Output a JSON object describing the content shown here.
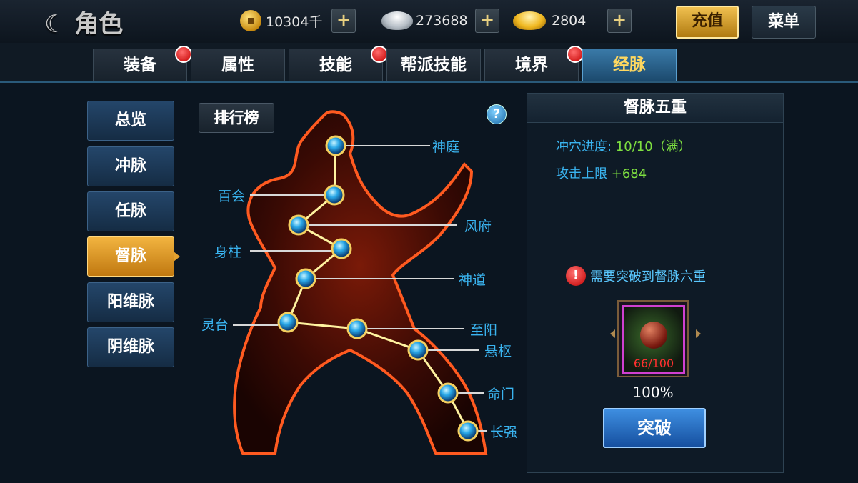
{
  "header": {
    "back_icon": "moon-back-icon",
    "title": "角色",
    "copper": "10304千",
    "silver": "273688",
    "gold": "2804",
    "recharge_label": "充值",
    "menu_label": "菜单"
  },
  "tabs": [
    {
      "label": "装备",
      "badge": true
    },
    {
      "label": "属性",
      "badge": false
    },
    {
      "label": "技能",
      "badge": true
    },
    {
      "label": "帮派技能",
      "badge": false
    },
    {
      "label": "境界",
      "badge": true
    },
    {
      "label": "经脉",
      "badge": false,
      "active": true
    }
  ],
  "sidebar": {
    "items": [
      {
        "label": "总览"
      },
      {
        "label": "冲脉"
      },
      {
        "label": "任脉"
      },
      {
        "label": "督脉",
        "active": true
      },
      {
        "label": "阳维脉"
      },
      {
        "label": "阴维脉"
      }
    ]
  },
  "ranking_label": "排行榜",
  "help_label": "?",
  "meridian_points": [
    {
      "label": "神庭"
    },
    {
      "label": "百会"
    },
    {
      "label": "风府"
    },
    {
      "label": "身柱"
    },
    {
      "label": "神道"
    },
    {
      "label": "灵台"
    },
    {
      "label": "至阳"
    },
    {
      "label": "悬枢"
    },
    {
      "label": "命门"
    },
    {
      "label": "长强"
    }
  ],
  "panel": {
    "title": "督脉五重",
    "progress_label": "冲穴进度:",
    "progress_value": "10/10（满）",
    "attack_label": "攻击上限",
    "attack_value": "+684",
    "warning": "需要突破到督脉六重",
    "item_count": "66/100",
    "percent": "100%",
    "break_label": "突破"
  },
  "colors": {
    "accent_blue": "#3ab4f0",
    "value_green": "#7ee040",
    "active_tab_text": "#ffd860",
    "badge_red": "#e01010"
  }
}
